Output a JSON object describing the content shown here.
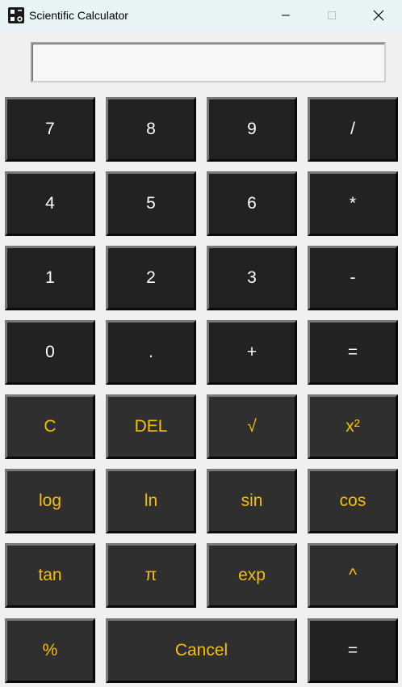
{
  "window": {
    "title": "Scientific Calculator",
    "controls": [
      "minimize",
      "maximize",
      "close"
    ]
  },
  "display": {
    "value": ""
  },
  "colors": {
    "button_bg": "#222222",
    "function_button_bg": "#2f2f2f",
    "digit_text": "#ffffff",
    "function_text": "#f5c000",
    "window_bg": "#f0f0f0",
    "titlebar_bg": "#e8f3f5"
  },
  "buttons": {
    "r1": [
      "7",
      "8",
      "9",
      "/"
    ],
    "r2": [
      "4",
      "5",
      "6",
      "*"
    ],
    "r3": [
      "1",
      "2",
      "3",
      "-"
    ],
    "r4": [
      "0",
      ".",
      "+",
      "="
    ],
    "r5": [
      "C",
      "DEL",
      "√",
      "x²"
    ],
    "r6": [
      "log",
      "ln",
      "sin",
      "cos"
    ],
    "r7": [
      "tan",
      "π",
      "exp",
      "^"
    ],
    "r8": [
      "%",
      "Cancel",
      "="
    ]
  }
}
